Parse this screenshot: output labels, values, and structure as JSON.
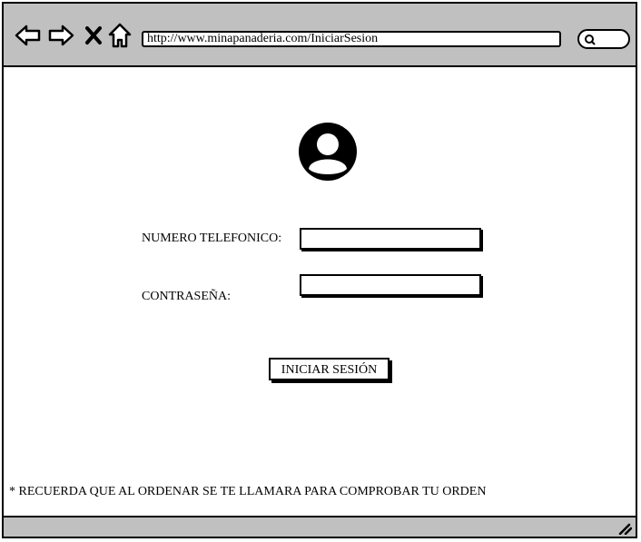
{
  "browser": {
    "url": "http://www.minapanaderia.com/IniciarSesion",
    "nav_icons": [
      "back-arrow-icon",
      "forward-arrow-icon",
      "close-x-icon",
      "home-icon"
    ],
    "search_icon": "search-icon"
  },
  "login_form": {
    "avatar_icon": "user-avatar-icon",
    "phone_label": "NUMERO TELEFONICO:",
    "phone_value": "",
    "password_label": "CONTRASEÑA:",
    "password_value": "",
    "submit_label": "INICIAR SESIÓN"
  },
  "footer_note": "* RECUERDA QUE AL ORDENAR SE TE LLAMARA PARA COMPROBAR TU ORDEN"
}
